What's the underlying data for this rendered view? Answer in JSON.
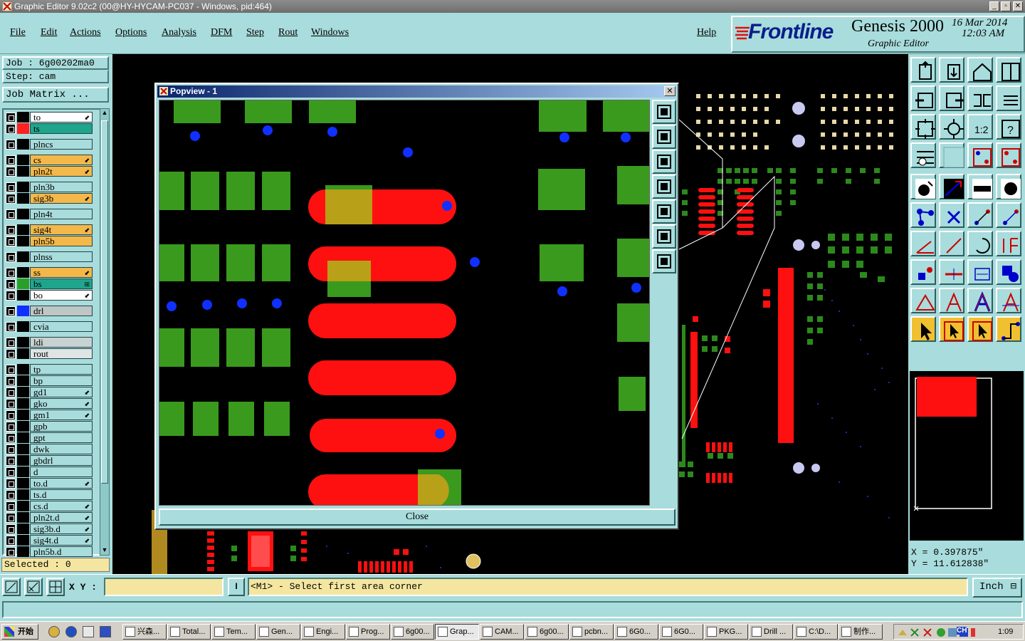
{
  "window": {
    "title": "Graphic Editor 9.02c2 (00@HY-HYCAM-PC037 - Windows, pid:464)"
  },
  "menu": {
    "items": [
      "File",
      "Edit",
      "Actions",
      "Options",
      "Analysis",
      "DFM",
      "Step",
      "Rout",
      "Windows"
    ],
    "help": "Help"
  },
  "brand": {
    "logo": "Frontline",
    "product": "Genesis 2000",
    "sub": "Graphic Editor",
    "date": "16 Mar 2014",
    "time": "12:03 AM"
  },
  "job": {
    "job_label": "Job : 6g00202ma0",
    "step_label": "Step: cam",
    "matrix_button": "Job Matrix ..."
  },
  "layers": [
    {
      "name": "to",
      "color": "#000000",
      "bg": "#ffffff",
      "mark": "⬋"
    },
    {
      "name": "ts",
      "color": "#ff2020",
      "bg": "#1fa58c",
      "mark": ""
    },
    {
      "name": "plncs",
      "color": "#000000",
      "bg": "#a9dcdc",
      "mark": ""
    },
    {
      "name": "cs",
      "color": "#000000",
      "bg": "#f4b84a",
      "mark": "⬋"
    },
    {
      "name": "pln2t",
      "color": "#000000",
      "bg": "#f4b84a",
      "mark": "⬋"
    },
    {
      "name": "pln3b",
      "color": "#000000",
      "bg": "#a9dcdc",
      "mark": ""
    },
    {
      "name": "sig3b",
      "color": "#000000",
      "bg": "#f4b84a",
      "mark": "⬋"
    },
    {
      "name": "pln4t",
      "color": "#000000",
      "bg": "#a9dcdc",
      "mark": ""
    },
    {
      "name": "sig4t",
      "color": "#000000",
      "bg": "#f4b84a",
      "mark": "⬋"
    },
    {
      "name": "pln5b",
      "color": "#000000",
      "bg": "#f4b84a",
      "mark": ""
    },
    {
      "name": "plnss",
      "color": "#000000",
      "bg": "#a9dcdc",
      "mark": ""
    },
    {
      "name": "ss",
      "color": "#000000",
      "bg": "#f4b84a",
      "mark": "⬋"
    },
    {
      "name": "bs",
      "color": "#28a028",
      "bg": "#1fa58c",
      "mark": "⊞"
    },
    {
      "name": "bo",
      "color": "#000000",
      "bg": "#ffffff",
      "mark": "⬋"
    },
    {
      "name": "drl",
      "color": "#1030ff",
      "bg": "#bfc6c6",
      "mark": ""
    },
    {
      "name": "cvia",
      "color": "#000000",
      "bg": "#a9dcdc",
      "mark": ""
    },
    {
      "name": "ldi",
      "color": "#000000",
      "bg": "#c9d2d2",
      "mark": ""
    },
    {
      "name": "rout",
      "color": "#000000",
      "bg": "#dfe4e4",
      "mark": ""
    },
    {
      "name": "tp",
      "color": "#000000",
      "bg": "#a9dcdc",
      "mark": ""
    },
    {
      "name": "bp",
      "color": "#000000",
      "bg": "#a9dcdc",
      "mark": ""
    },
    {
      "name": "gd1",
      "color": "#000000",
      "bg": "#a9dcdc",
      "mark": "⬋"
    },
    {
      "name": "gko",
      "color": "#000000",
      "bg": "#a9dcdc",
      "mark": "⬋"
    },
    {
      "name": "gm1",
      "color": "#000000",
      "bg": "#a9dcdc",
      "mark": "⬋"
    },
    {
      "name": "gpb",
      "color": "#000000",
      "bg": "#a9dcdc",
      "mark": ""
    },
    {
      "name": "gpt",
      "color": "#000000",
      "bg": "#a9dcdc",
      "mark": ""
    },
    {
      "name": "dwk",
      "color": "#000000",
      "bg": "#a9dcdc",
      "mark": ""
    },
    {
      "name": "gbdrl",
      "color": "#000000",
      "bg": "#a9dcdc",
      "mark": ""
    },
    {
      "name": "d",
      "color": "#000000",
      "bg": "#a9dcdc",
      "mark": ""
    },
    {
      "name": "to.d",
      "color": "#000000",
      "bg": "#a9dcdc",
      "mark": "⬋"
    },
    {
      "name": "ts.d",
      "color": "#000000",
      "bg": "#a9dcdc",
      "mark": ""
    },
    {
      "name": "cs.d",
      "color": "#000000",
      "bg": "#a9dcdc",
      "mark": "⬋"
    },
    {
      "name": "pln2t.d",
      "color": "#000000",
      "bg": "#a9dcdc",
      "mark": "⬋"
    },
    {
      "name": "sig3b.d",
      "color": "#000000",
      "bg": "#a9dcdc",
      "mark": "⬋"
    },
    {
      "name": "sig4t.d",
      "color": "#000000",
      "bg": "#a9dcdc",
      "mark": "⬋"
    },
    {
      "name": "pln5b.d",
      "color": "#000000",
      "bg": "#a9dcdc",
      "mark": ""
    }
  ],
  "selected": "Selected : 0",
  "popview": {
    "title": "Popview - 1",
    "close": "Close"
  },
  "coords": {
    "x": "X  =  0.397875\"",
    "y": "Y  =  11.612838\""
  },
  "status": {
    "xy_label": "X Y :",
    "xy_value": "",
    "prompt": "<M1> - Select first area corner",
    "units": "Inch"
  },
  "taskbar": {
    "start": "开始",
    "clock": "1:09",
    "tasks": [
      "兴森...",
      "Total...",
      "Tem...",
      "Gen...",
      "Engi...",
      "Prog...",
      "6g00...",
      "Grap...",
      "CAM...",
      "6g00...",
      "pcbn...",
      "6G0...",
      "6G0...",
      "PKG...",
      "Drill ...",
      "C:\\D...",
      "制作..."
    ]
  },
  "colors": {
    "panel": "#a9dcdc",
    "canvas": "#000000",
    "copper_green": "#3a9a1e",
    "mask_red": "#ff1010",
    "drill_blue": "#1030ff"
  }
}
